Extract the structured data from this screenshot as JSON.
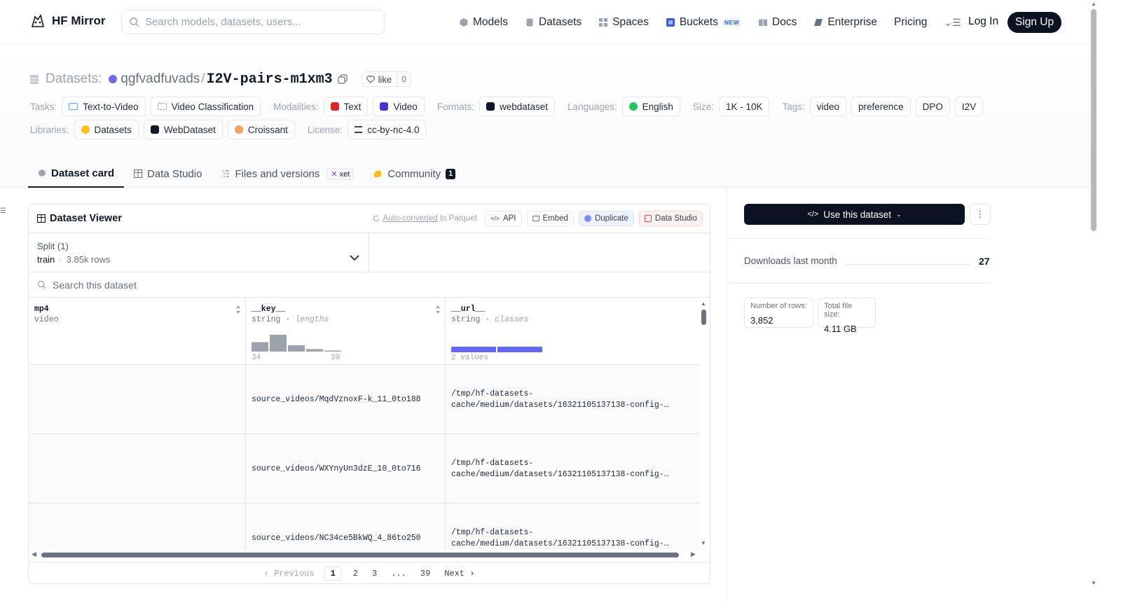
{
  "nav": {
    "brand": "HF Mirror",
    "search_placeholder": "Search models, datasets, users...",
    "links": [
      {
        "label": "Models",
        "icon": "cube-icon"
      },
      {
        "label": "Datasets",
        "icon": "database-icon"
      },
      {
        "label": "Spaces",
        "icon": "grid-icon"
      },
      {
        "label": "Buckets",
        "icon": "bucket-icon",
        "badge": "NEW"
      },
      {
        "label": "Docs",
        "icon": "book-icon"
      },
      {
        "label": "Enterprise",
        "icon": "enterprise-icon"
      },
      {
        "label": "Pricing"
      }
    ],
    "login": "Log In",
    "signup": "Sign Up"
  },
  "header": {
    "kind": "Datasets:",
    "owner": "qgfvadfuvads",
    "name": "I2V-pairs-m1xm3",
    "like_label": "like",
    "like_count": "0"
  },
  "tags": {
    "tasks_label": "Tasks:",
    "tasks": [
      "Text-to-Video",
      "Video Classification"
    ],
    "modalities_label": "Modalities:",
    "modalities": [
      "Text",
      "Video"
    ],
    "formats_label": "Formats:",
    "formats": [
      "webdataset"
    ],
    "languages_label": "Languages:",
    "languages": [
      "English"
    ],
    "size_label": "Size:",
    "size": [
      "1K - 10K"
    ],
    "tags_label": "Tags:",
    "tags": [
      "video",
      "preference",
      "DPO",
      "I2V"
    ],
    "libraries_label": "Libraries:",
    "libraries": [
      "Datasets",
      "WebDataset",
      "Croissant"
    ],
    "license_label": "License:",
    "license": [
      "cc-by-nc-4.0"
    ]
  },
  "tabs": [
    {
      "label": "Dataset card",
      "active": true
    },
    {
      "label": "Data Studio"
    },
    {
      "label": "Files and versions",
      "badge": "xet"
    },
    {
      "label": "Community",
      "count": "1"
    }
  ],
  "viewer": {
    "title": "Dataset Viewer",
    "auto_converted": "Auto-converted",
    "to_parquet": " to Parquet",
    "buttons": [
      "API",
      "Embed",
      "Duplicate",
      "Data Studio"
    ],
    "split_label": "Split (1)",
    "split_name": "train",
    "split_rows": "3.85k rows",
    "search_placeholder": "Search this dataset",
    "columns": [
      {
        "name": "mp4",
        "type": "video",
        "stat": ""
      },
      {
        "name": "__key__",
        "type": "string",
        "stat": "lengths",
        "min": "34",
        "max": "39",
        "hist": [
          0.45,
          0.8,
          0.3,
          0.12,
          0.05
        ]
      },
      {
        "name": "__url__",
        "type": "string",
        "stat": "classes",
        "note": "2 values",
        "classes": [
          0.5,
          0.5
        ]
      }
    ],
    "rows": [
      {
        "mp4": "",
        "key": "source_videos/MqdVznoxF-k_11_0to188",
        "url1": "/tmp/hf-datasets-",
        "url2": "cache/medium/datasets/16321105137138-config-…"
      },
      {
        "mp4": "",
        "key": "source_videos/WXYnyUn3dzE_10_0to716",
        "url1": "/tmp/hf-datasets-",
        "url2": "cache/medium/datasets/16321105137138-config-…"
      },
      {
        "mp4": "",
        "key": "source_videos/NC34ce5BkWQ_4_86to250",
        "url1": "/tmp/hf-datasets-",
        "url2": "cache/medium/datasets/16321105137138-config-…"
      }
    ],
    "pager": {
      "prev": "‹ Previous",
      "pages": [
        "1",
        "2",
        "3",
        "...",
        "39"
      ],
      "current": "1",
      "next": "Next ›"
    }
  },
  "sidebar": {
    "use_label": "Use this dataset",
    "downloads_label": "Downloads last month",
    "downloads_value": "27",
    "stats": [
      {
        "label": "Number of rows:",
        "value": "3,852"
      },
      {
        "label": "Total file size:",
        "value": "4.11 GB"
      }
    ]
  },
  "colors": {
    "accent": "#6366f1",
    "dark": "#0b1222",
    "avatar": "#6d6af0"
  }
}
